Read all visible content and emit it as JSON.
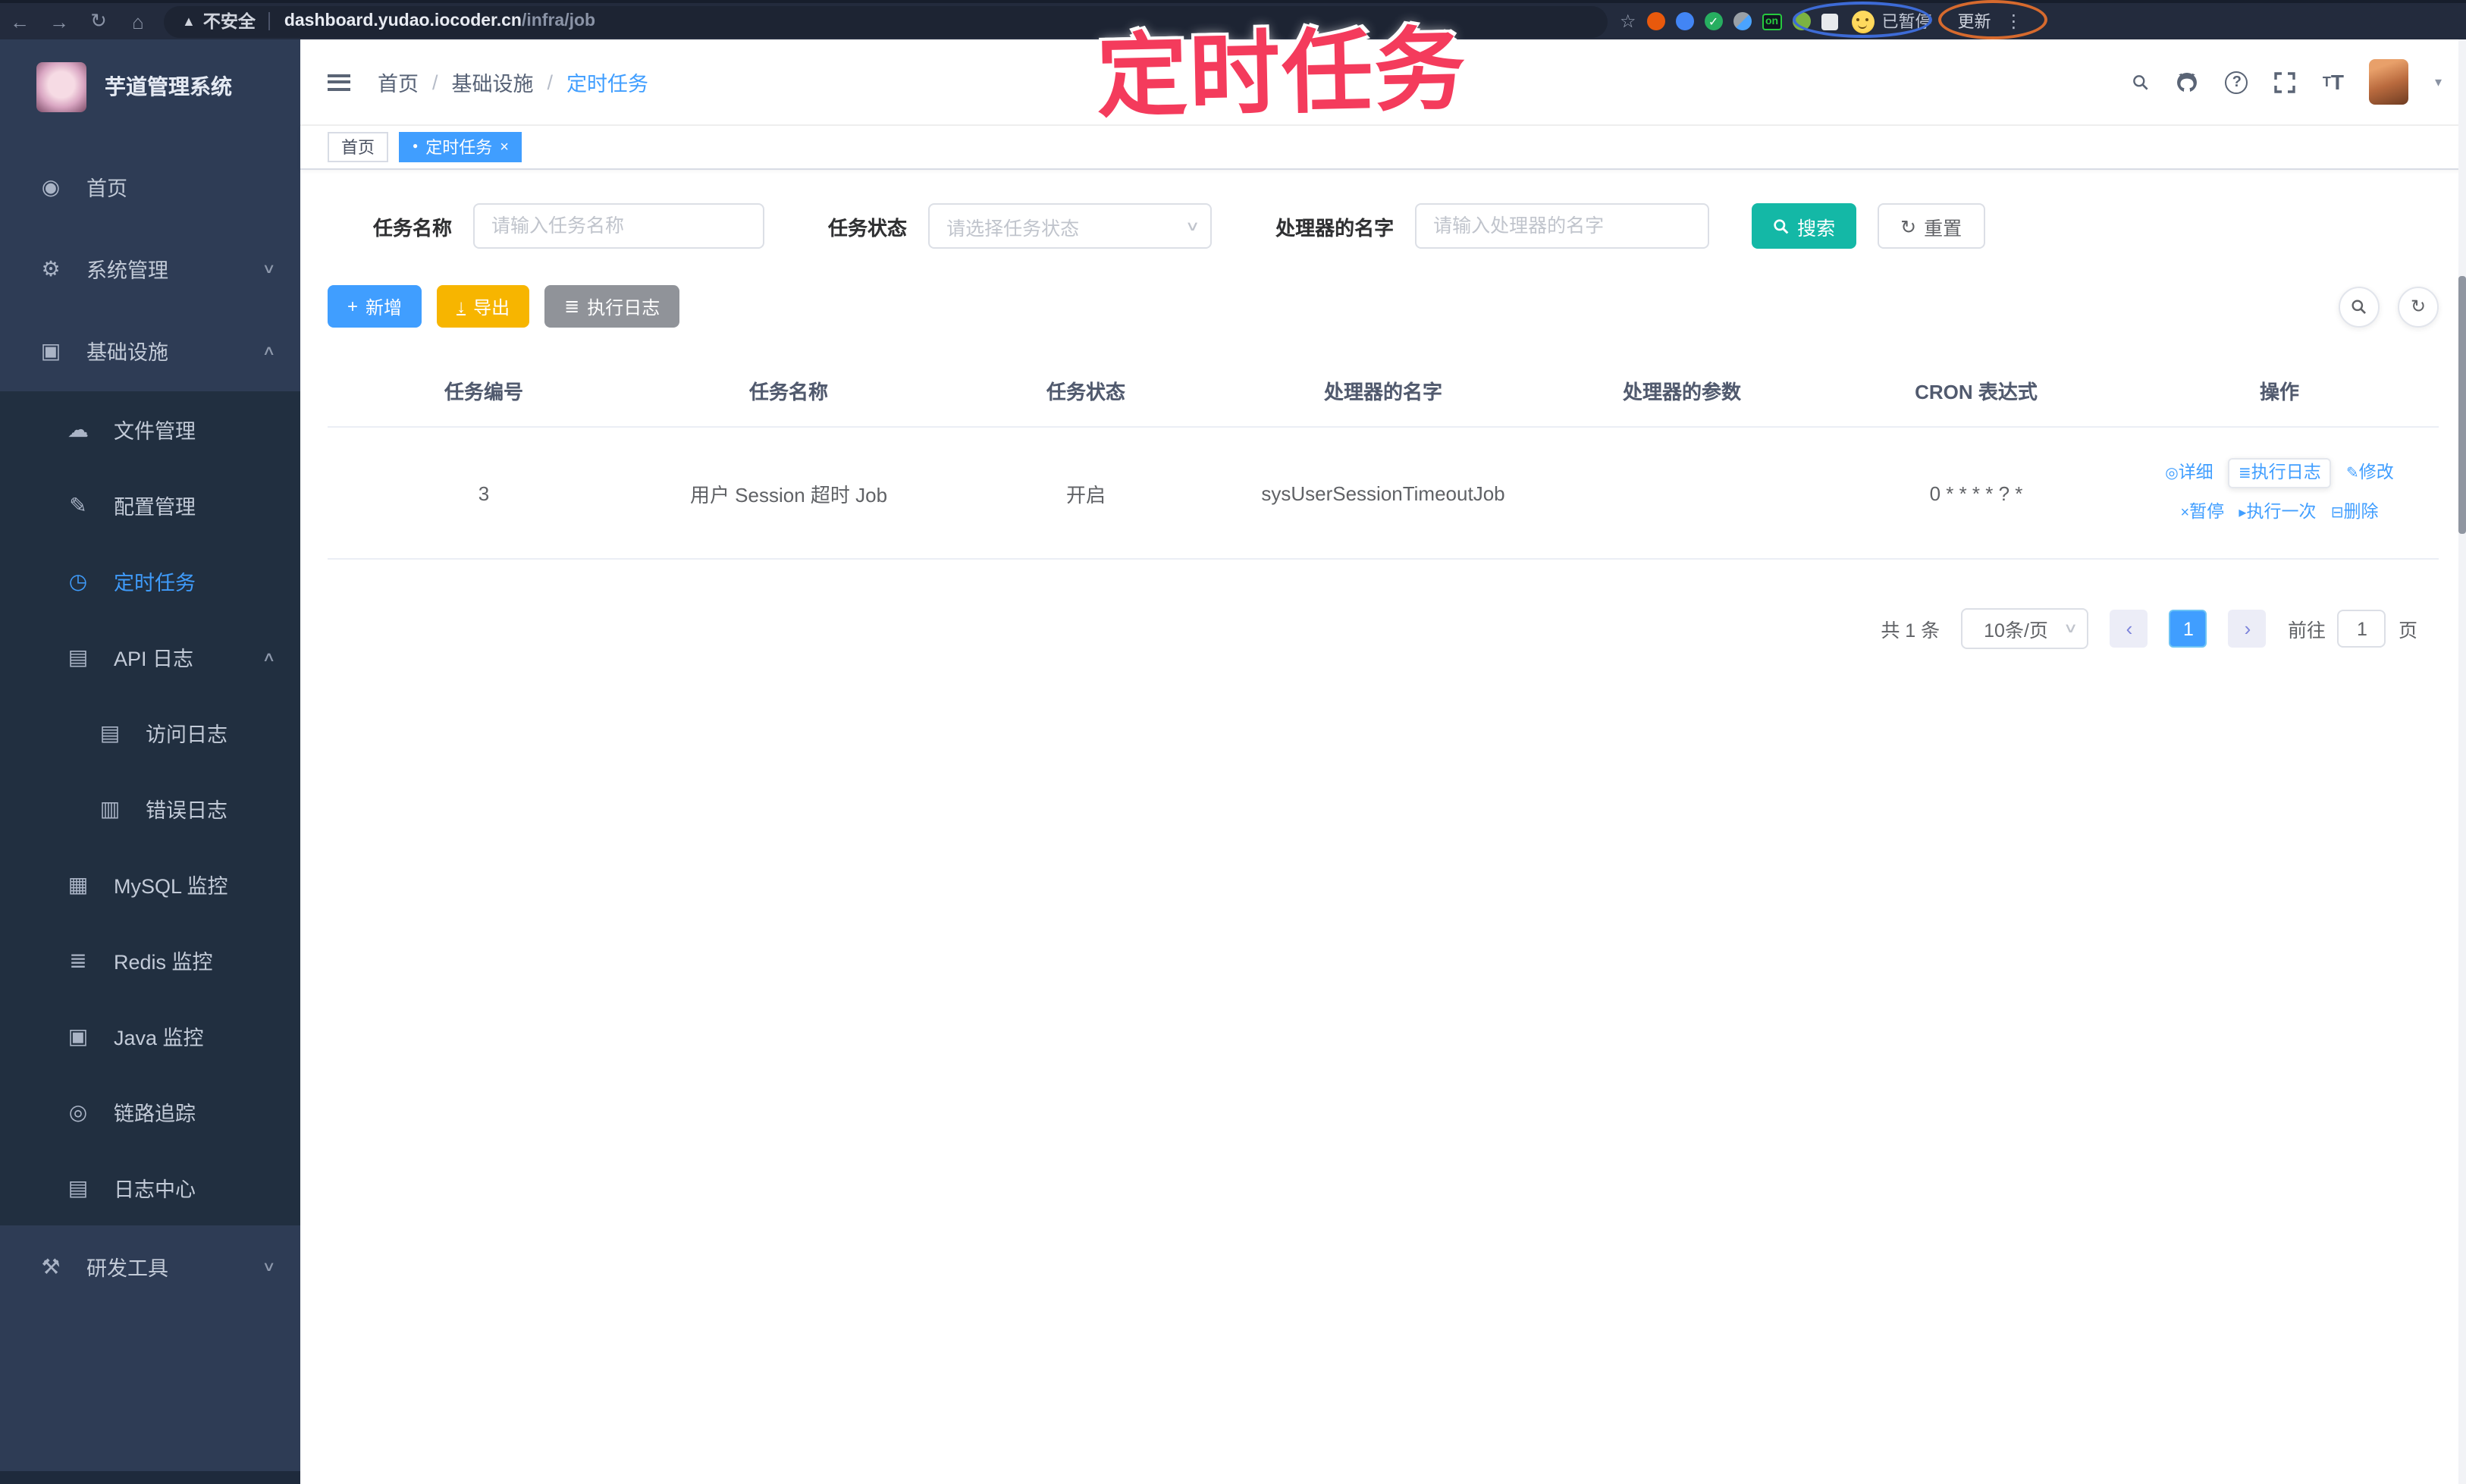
{
  "browser": {
    "security_label": "不安全",
    "url_host": "dashboard.yudao.iocoder.cn",
    "url_path": "/infra/job",
    "paused_label": "已暂停",
    "update_label": "更新",
    "ext_on_badge": "on"
  },
  "icons": {
    "back": "←",
    "forward": "→",
    "reload": "↻",
    "home": "⌂",
    "warning": "▲",
    "star": "☆",
    "kebab": "⋮",
    "check": "✓",
    "help": "?",
    "caret": "▾",
    "chevron_down": "∨",
    "chevron_up": "∧",
    "plus": "+",
    "download": "↓",
    "list": "≣",
    "refresh": "↻",
    "detail": "◎",
    "edit": "✎",
    "pause": "×",
    "play": "▸",
    "trash": "⊟",
    "prev": "‹",
    "next": "›",
    "dot": "●",
    "close": "×",
    "font_big": "T",
    "font_small": "T"
  },
  "sidebar": {
    "logo_title": "芋道管理系统",
    "items": [
      {
        "label": "首页",
        "icon": "◉"
      },
      {
        "label": "系统管理",
        "icon": "⚙"
      },
      {
        "label": "基础设施",
        "icon": "▣"
      },
      {
        "label": "文件管理",
        "icon": "☁"
      },
      {
        "label": "配置管理",
        "icon": "✎"
      },
      {
        "label": "定时任务",
        "icon": "◷"
      },
      {
        "label": "API 日志",
        "icon": "▤"
      },
      {
        "label": "访问日志",
        "icon": "▤"
      },
      {
        "label": "错误日志",
        "icon": "▥"
      },
      {
        "label": "MySQL 监控",
        "icon": "▦"
      },
      {
        "label": "Redis 监控",
        "icon": "≣"
      },
      {
        "label": "Java 监控",
        "icon": "▣"
      },
      {
        "label": "链路追踪",
        "icon": "◎"
      },
      {
        "label": "日志中心",
        "icon": "▤"
      },
      {
        "label": "研发工具",
        "icon": "⚒"
      }
    ]
  },
  "navbar": {
    "breadcrumb": [
      "首页",
      "基础设施",
      "定时任务"
    ],
    "separator": "/"
  },
  "tabs": [
    {
      "label": "首页"
    },
    {
      "label": "定时任务"
    }
  ],
  "annotation": {
    "text": "定时任务"
  },
  "filters": {
    "name_label": "任务名称",
    "name_placeholder": "请输入任务名称",
    "status_label": "任务状态",
    "status_placeholder": "请选择任务状态",
    "handler_label": "处理器的名字",
    "handler_placeholder": "请输入处理器的名字",
    "search_label": "搜索",
    "reset_label": "重置"
  },
  "toolbar": {
    "add_label": "新增",
    "export_label": "导出",
    "exec_log_label": "执行日志"
  },
  "table": {
    "headers": [
      "任务编号",
      "任务名称",
      "任务状态",
      "处理器的名字",
      "处理器的参数",
      "CRON 表达式",
      "操作"
    ],
    "rows": [
      {
        "id": "3",
        "name": "用户 Session 超时 Job",
        "status": "开启",
        "handler": "sysUserSessionTimeoutJob",
        "param": "",
        "cron": "0 * * * * ? *"
      }
    ],
    "actions": [
      "详细",
      "执行日志",
      "修改",
      "暂停",
      "执行一次",
      "删除"
    ]
  },
  "pagination": {
    "total": "共 1 条",
    "page_size": "10条/页",
    "page": "1",
    "goto_label": "前往",
    "goto_value": "1",
    "page_unit": "页"
  },
  "colors": {
    "primary": "#409eff",
    "search_teal": "#14b8a6",
    "export_yellow": "#f7b500",
    "info_gray": "#909399",
    "sidebar_bg": "#2e3c55",
    "submenu_bg": "#212f40",
    "annotation_pink": "#f43b5c"
  }
}
